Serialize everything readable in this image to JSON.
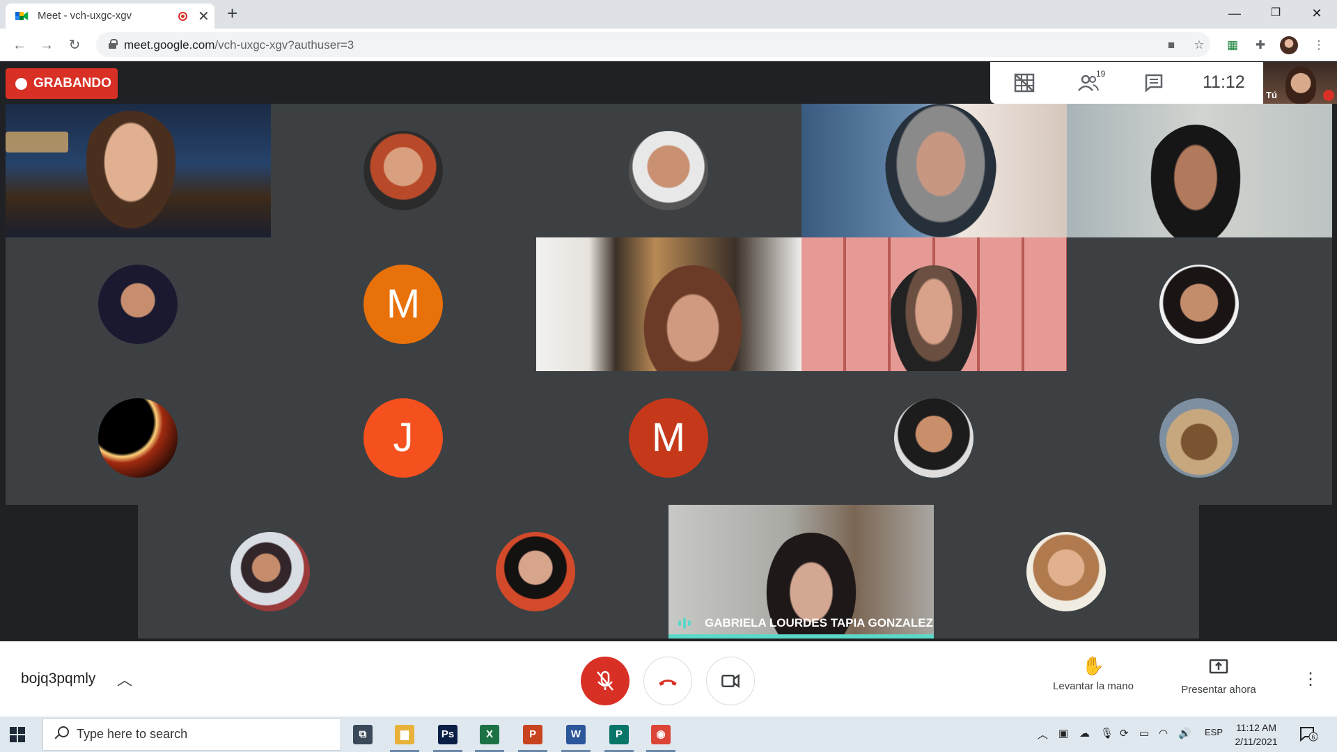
{
  "browser": {
    "tab_title": "Meet - vch-uxgc-xgv",
    "url_host": "meet.google.com",
    "url_path": "/vch-uxgc-xgv?authuser=3",
    "new_tab_symbol": "+",
    "close_tab_symbol": "✕",
    "window_buttons": [
      "—",
      "❐",
      "✕"
    ]
  },
  "meet": {
    "recording_label": "GRABANDO",
    "participant_count": "19",
    "clock": "11:12",
    "self_label": "Tú",
    "active_speaker": "GABRIELA LOURDES TAPIA GONZALEZ",
    "tiles": [
      {
        "kind": "video",
        "scene": "porch-night"
      },
      {
        "kind": "avatar",
        "photo": "woman-glasses-smiling"
      },
      {
        "kind": "avatar",
        "photo": "man-bald-smiling"
      },
      {
        "kind": "video",
        "scene": "woman-glasses-sea"
      },
      {
        "kind": "video",
        "scene": "woman-dark-hair-wall"
      },
      {
        "kind": "avatar",
        "photo": "woman-dark-portrait"
      },
      {
        "kind": "letter",
        "letter": "M",
        "color": "#e8710a"
      },
      {
        "kind": "video",
        "scene": "woman-bookshelf"
      },
      {
        "kind": "video",
        "scene": "woman-pink-wall"
      },
      {
        "kind": "avatar",
        "photo": "woman-smiling-portrait"
      },
      {
        "kind": "avatar",
        "photo": "planet-eclipse"
      },
      {
        "kind": "letter",
        "letter": "J",
        "color": "#f4511e"
      },
      {
        "kind": "letter",
        "letter": "M",
        "color": "#c5391a"
      },
      {
        "kind": "avatar",
        "photo": "man-suit-smiling"
      },
      {
        "kind": "avatar",
        "photo": "giraffe-statue"
      },
      {
        "kind": "avatar",
        "photo": "woman-with-child"
      },
      {
        "kind": "avatar",
        "photo": "woman-dark-hair-red"
      },
      {
        "kind": "video",
        "scene": "gabriela-speaking"
      },
      {
        "kind": "avatar",
        "photo": "woman-blond-smiling"
      }
    ]
  },
  "controls": {
    "meeting_code": "bojq3pqmly",
    "raise_hand_label": "Levantar la mano",
    "present_label": "Presentar ahora"
  },
  "taskbar": {
    "search_placeholder": "Type here to search",
    "language": "ESP",
    "time": "11:12 AM",
    "date": "2/11/2021",
    "notification_count": "6",
    "apps": [
      {
        "name": "task-view",
        "label": "⧉",
        "color": "#3a4a5a"
      },
      {
        "name": "file-explorer",
        "label": "▆",
        "color": "#e8b23a"
      },
      {
        "name": "photoshop",
        "label": "Ps",
        "color": "#0a1f44"
      },
      {
        "name": "excel",
        "label": "X",
        "color": "#1d7244"
      },
      {
        "name": "powerpoint",
        "label": "P",
        "color": "#c8441f"
      },
      {
        "name": "word",
        "label": "W",
        "color": "#2b579a"
      },
      {
        "name": "publisher",
        "label": "P",
        "color": "#077568"
      },
      {
        "name": "chrome",
        "label": "◉",
        "color": "#db4437"
      }
    ]
  }
}
